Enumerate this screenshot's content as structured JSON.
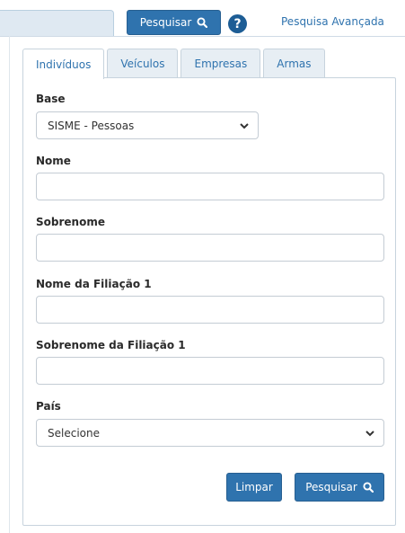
{
  "topbar": {
    "search_button_label": "Pesquisar",
    "advanced_link": "Pesquisa Avançada"
  },
  "tabs": [
    {
      "label": "Indivíduos",
      "active": true
    },
    {
      "label": "Veículos",
      "active": false
    },
    {
      "label": "Empresas",
      "active": false
    },
    {
      "label": "Armas",
      "active": false
    }
  ],
  "form": {
    "base_label": "Base",
    "base_value": "SISME - Pessoas",
    "nome_label": "Nome",
    "nome_value": "",
    "sobrenome_label": "Sobrenome",
    "sobrenome_value": "",
    "filiacao_nome_label": "Nome da Filiação 1",
    "filiacao_nome_value": "",
    "filiacao_sobrenome_label": "Sobrenome da Filiação 1",
    "filiacao_sobrenome_value": "",
    "pais_label": "País",
    "pais_value": "Selecione"
  },
  "actions": {
    "clear_label": "Limpar",
    "search_label": "Pesquisar"
  },
  "colors": {
    "primary": "#2f73ae",
    "help_icon": "#1d5d95"
  },
  "icons": [
    "search-icon",
    "help-icon",
    "chevron-down-icon"
  ]
}
